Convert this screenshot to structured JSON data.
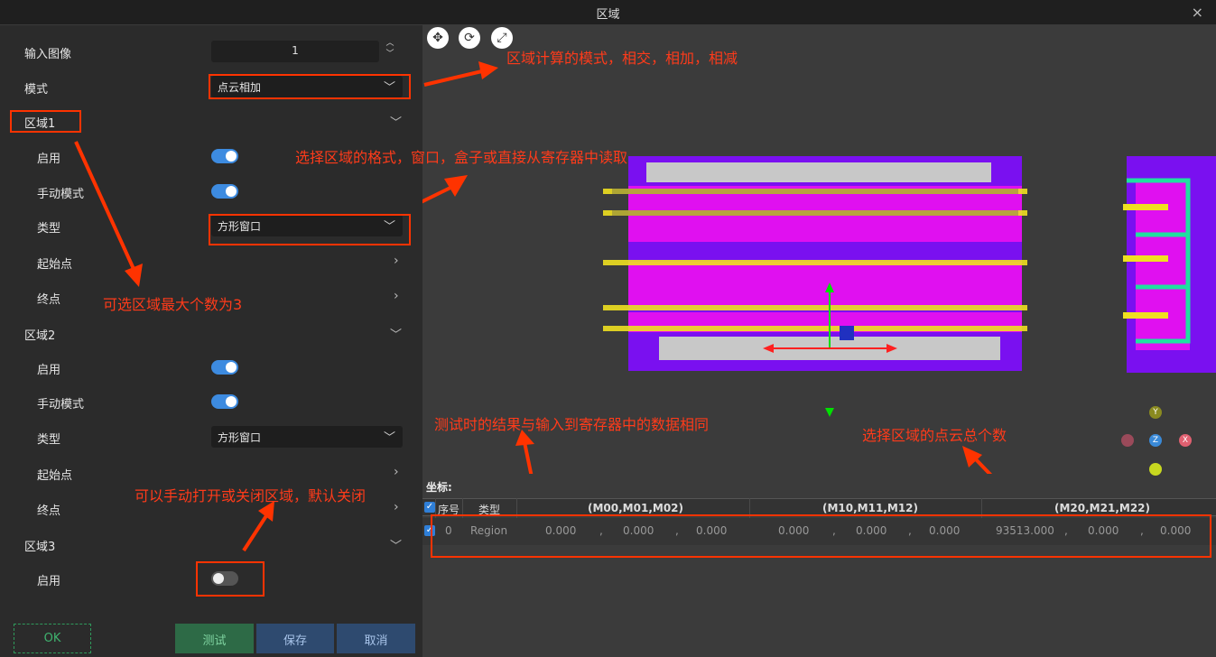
{
  "window": {
    "title": "区域",
    "close_glyph": "×"
  },
  "form": {
    "input_image": {
      "label": "输入图像",
      "value": "1"
    },
    "mode": {
      "label": "模式",
      "value": "点云相加"
    },
    "regions": [
      {
        "label": "区域1",
        "enable_label": "启用",
        "enable_on": true,
        "manual_label": "手动模式",
        "manual_on": true,
        "type_label": "类型",
        "type_value": "方形窗口",
        "start_label": "起始点",
        "end_label": "终点"
      },
      {
        "label": "区域2",
        "enable_label": "启用",
        "enable_on": true,
        "manual_label": "手动模式",
        "manual_on": true,
        "type_label": "类型",
        "type_value": "方形窗口",
        "start_label": "起始点",
        "end_label": "终点"
      },
      {
        "label": "区域3",
        "enable_label": "启用",
        "enable_on": false
      }
    ]
  },
  "buttons": {
    "ok": "OK",
    "test": "测试",
    "save": "保存",
    "cancel": "取消"
  },
  "annotations": {
    "mode_note": "区域计算的模式，相交，相加，相减",
    "type_note": "选择区域的格式，窗口，盒子或直接从寄存器中读取",
    "max_note": "可选区域最大个数为3",
    "toggle_note": "可以手动打开或关闭区域，默认关闭",
    "result_note": "测试时的结果与输入到寄存器中的数据相同",
    "count_note": "选择区域的点云总个数"
  },
  "viewer": {
    "tools": [
      "move-icon",
      "rotate-icon",
      "fit-icon"
    ],
    "axes": [
      "Y",
      "Z",
      "X"
    ]
  },
  "coords": {
    "title": "坐标:",
    "headers": [
      "序号",
      "类型",
      "(M00,M01,M02)",
      "(M10,M11,M12)",
      "(M20,M21,M22)"
    ],
    "rows": [
      {
        "index": "0",
        "type": "Region",
        "m0": [
          "0.000",
          "0.000",
          "0.000"
        ],
        "m1": [
          "0.000",
          "0.000",
          "0.000"
        ],
        "m2": [
          "93513.000",
          "0.000",
          "0.000"
        ]
      }
    ],
    "separator": ","
  },
  "colors": {
    "accent": "#3d8be0",
    "annotation": "#ff3b1a",
    "ok": "#3fb36f"
  }
}
